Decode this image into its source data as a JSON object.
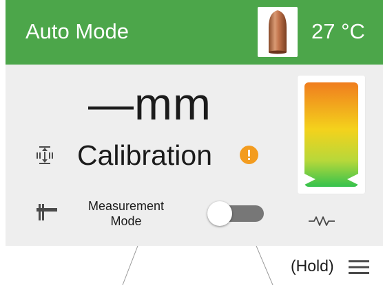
{
  "header": {
    "title": "Auto Mode",
    "temperature": "27 °C",
    "bullet_icon": "bullet-icon",
    "background_color": "#4ca64a"
  },
  "main": {
    "reading": "—mm",
    "calibration_label": "Calibration",
    "calibration_icon": "depth-measure-icon",
    "warning_icon": "warning-icon",
    "warning_color": "#f39c1f",
    "measurement_mode_label_line1": "Measurement",
    "measurement_mode_label_line2": "Mode",
    "measurement_mode_icon": "caliper-icon",
    "measurement_mode_on": false,
    "level_meter_icon": "gradient-level-meter",
    "resistor_icon": "resistor-icon"
  },
  "footer": {
    "hold_label": "(Hold)",
    "menu_icon": "hamburger-menu-icon"
  }
}
